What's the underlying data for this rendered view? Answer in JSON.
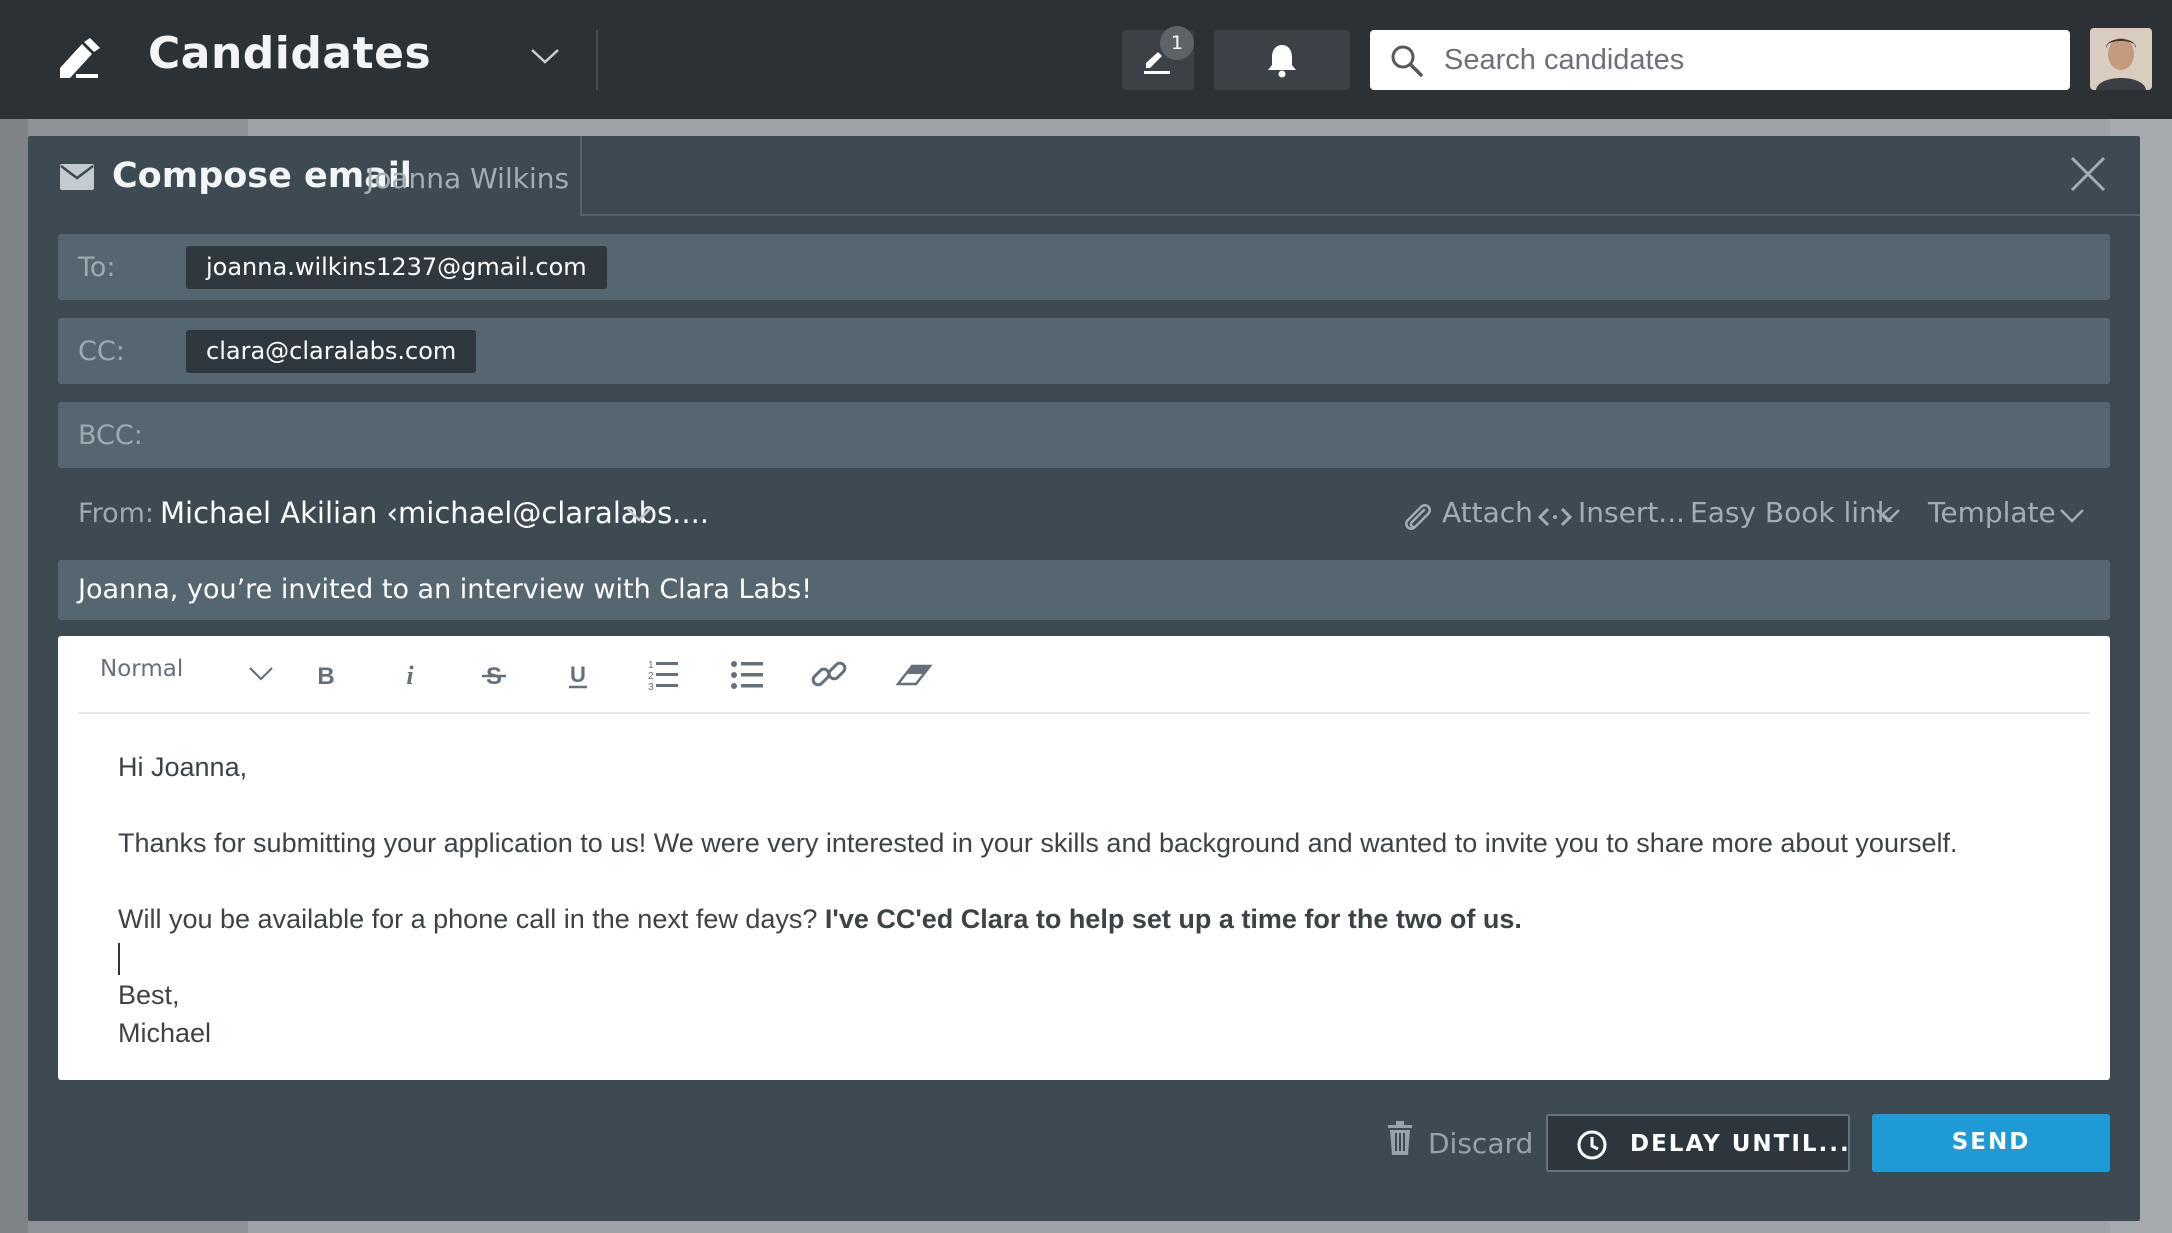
{
  "topbar": {
    "title": "Candidates",
    "tasks_badge": "1",
    "search_placeholder": "Search candidates"
  },
  "compose": {
    "title": "Compose email",
    "recipient_name": "Joanna Wilkins",
    "to_label": "To:",
    "to_chip": "joanna.wilkins1237@gmail.com",
    "cc_label": "CC:",
    "cc_chip": "clara@claralabs.com",
    "bcc_label": "BCC:",
    "from_label": "From:",
    "from_value": "Michael Akilian ‹michael@claralabs....",
    "tools": {
      "attach": "Attach",
      "insert": "Insert...",
      "easy_book": "Easy Book link",
      "template": "Template"
    },
    "subject": "Joanna, you’re invited to an interview with Clara Labs!",
    "format_select": "Normal",
    "body": {
      "greeting": "Hi Joanna,",
      "paragraph1": "Thanks for submitting your application to us!  We were very interested in your skills and background and wanted to invite you to share more about yourself.",
      "paragraph2_plain": "Will you be available for a phone call in the next few days?  ",
      "paragraph2_bold": "I've CC'ed Clara to help set up a time for the two of us.",
      "signoff": "Best,",
      "signature": "Michael"
    },
    "discard_label": "Discard",
    "delay_label": "DELAY UNTIL...",
    "send_label": "SEND"
  },
  "colors": {
    "topbar": "#2c3135",
    "modal": "#3e4a52",
    "field": "#566670",
    "send": "#1e9bd7"
  }
}
